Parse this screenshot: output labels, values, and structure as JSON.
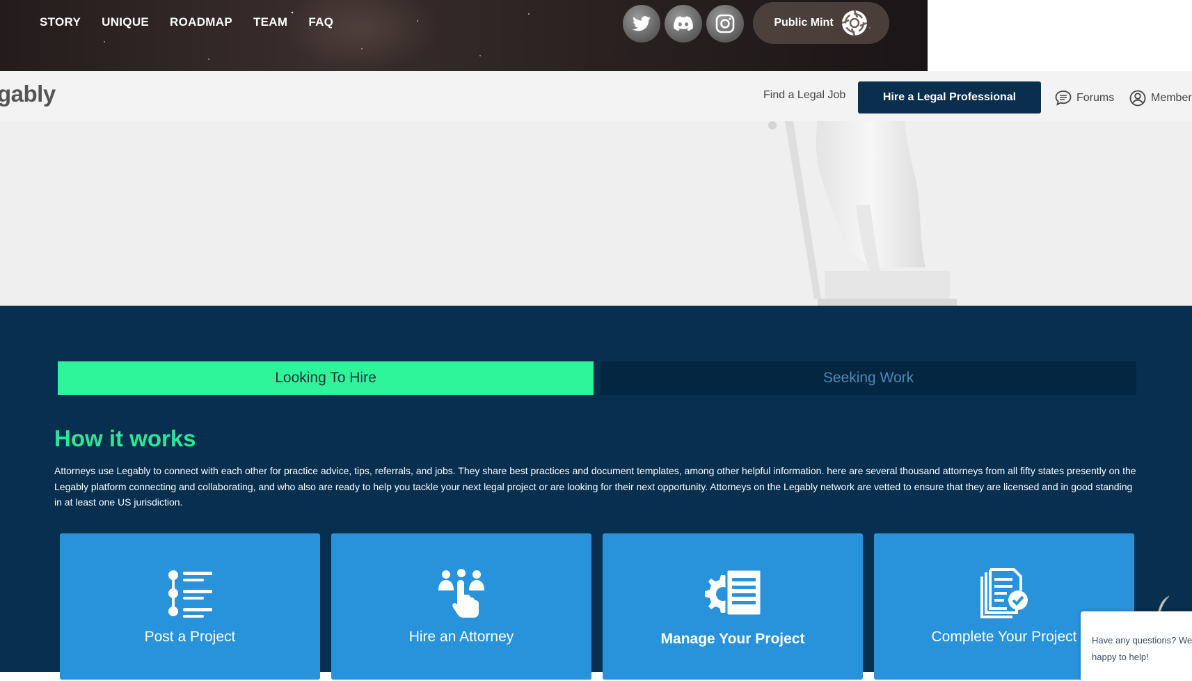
{
  "topnav": {
    "items": [
      "STORY",
      "UNIQUE",
      "ROADMAP",
      "TEAM",
      "FAQ"
    ],
    "social": [
      "twitter-icon",
      "discord-icon",
      "instagram-icon"
    ],
    "mint_label": "Public Mint"
  },
  "header": {
    "brand": "gably",
    "find_job": "Find a Legal Job",
    "hire_button": "Hire a Legal Professional",
    "forums": "Forums",
    "members": "Member"
  },
  "tabs": {
    "active": "Looking To Hire",
    "inactive": "Seeking Work"
  },
  "how_it_works": {
    "title": "How it works",
    "description": "Attorneys use Legably to connect with each other for practice advice, tips, referrals, and jobs. They share best practices and document templates, among other helpful information. here are several thousand attorneys from all fifty states presently on the Legably platform connecting and collaborating, and who also are ready to help you tackle your next legal project or are looking for their next opportunity. Attorneys on the Legably network are vetted to ensure that they are licensed and in good standing in at least one US jurisdiction."
  },
  "steps": [
    {
      "label": "Post a Project",
      "icon": "list-icon"
    },
    {
      "label": "Hire an Attorney",
      "icon": "people-pointer-icon"
    },
    {
      "label": "Manage Your Project",
      "icon": "gear-document-icon"
    },
    {
      "label": "Complete Your Project",
      "icon": "document-check-icon"
    }
  ],
  "chat": {
    "text": "Have any questions? We're happy to help!"
  },
  "colors": {
    "accent_green": "#2ff59a",
    "navy": "#072f50",
    "card_blue": "#2893db",
    "hire_button": "#0a2e4e"
  }
}
